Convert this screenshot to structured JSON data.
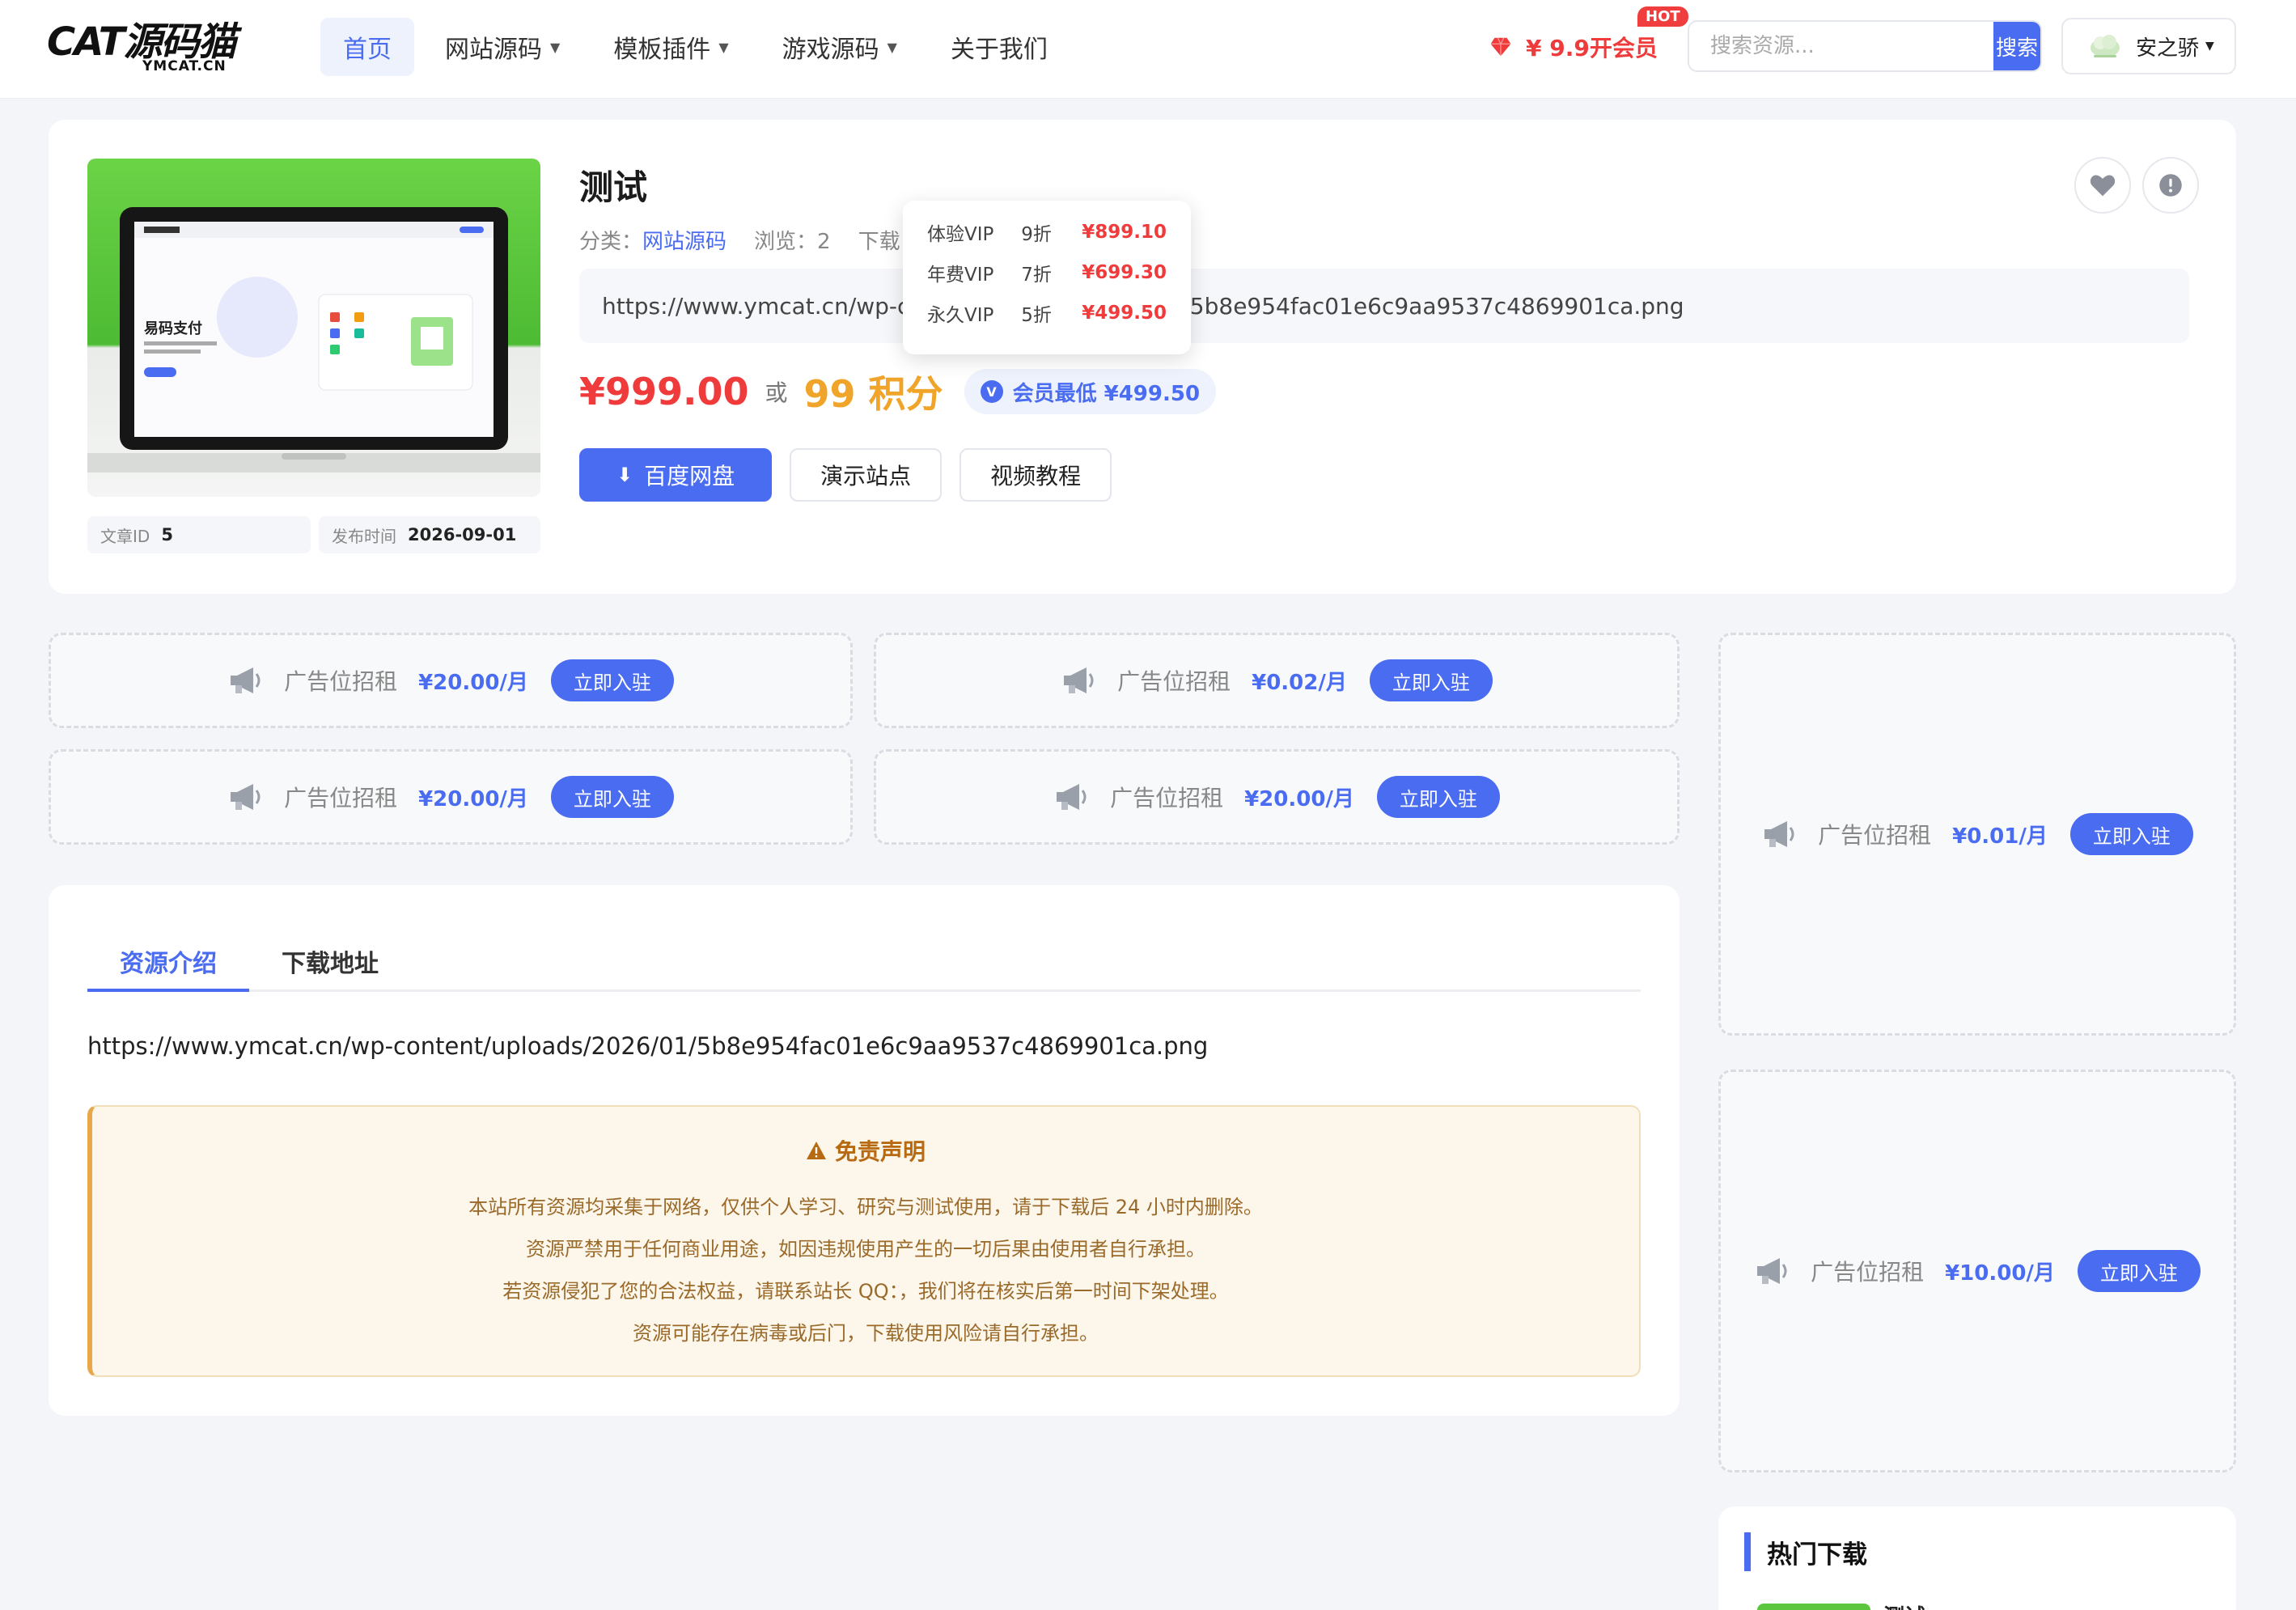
{
  "header": {
    "logo_main": "CAT源码猫",
    "logo_sub": "YMCAT.CN",
    "nav": [
      {
        "label": "首页",
        "active": true,
        "caret": false
      },
      {
        "label": "网站源码",
        "active": false,
        "caret": true
      },
      {
        "label": "模板插件",
        "active": false,
        "caret": true
      },
      {
        "label": "游戏源码",
        "active": false,
        "caret": true
      },
      {
        "label": "关于我们",
        "active": false,
        "caret": false
      }
    ],
    "vip_link": "¥ 9.9开会员",
    "hot_badge": "HOT",
    "search_placeholder": "搜索资源...",
    "search_button": "搜索",
    "user_name": "安之骄"
  },
  "product": {
    "title": "测试",
    "category_label": "分类：",
    "category_value": "网站源码",
    "views": "浏览：2",
    "downloads_label": "下载",
    "url": "https://www.ymcat.cn/wp-content/uploads/2026/01/5b8e954fac01e6c9aa9537c4869901ca.png",
    "price": "¥999.00",
    "or": "或",
    "points": "99 积分",
    "member_badge": "V",
    "member_min": "会员最低 ¥499.50",
    "buttons": {
      "primary": "百度网盘",
      "demo": "演示站点",
      "video": "视频教程"
    },
    "article_id_label": "文章ID",
    "article_id": "5",
    "publish_label": "发布时间",
    "publish_date": "2026-09-01",
    "thumb_text": "易码支付"
  },
  "vip_popup": [
    {
      "level": "体验VIP",
      "discount": "9折",
      "price": "¥899.10"
    },
    {
      "level": "年费VIP",
      "discount": "7折",
      "price": "¥699.30"
    },
    {
      "level": "永久VIP",
      "discount": "5折",
      "price": "¥499.50"
    }
  ],
  "ads": [
    {
      "text": "广告位招租",
      "price": "¥20.00/月",
      "button": "立即入驻"
    },
    {
      "text": "广告位招租",
      "price": "¥0.02/月",
      "button": "立即入驻"
    },
    {
      "text": "广告位招租",
      "price": "¥20.00/月",
      "button": "立即入驻"
    },
    {
      "text": "广告位招租",
      "price": "¥20.00/月",
      "button": "立即入驻"
    },
    {
      "text": "广告位招租",
      "price": "¥0.01/月",
      "button": "立即入驻"
    },
    {
      "text": "广告位招租",
      "price": "¥10.00/月",
      "button": "立即入驻"
    }
  ],
  "content": {
    "tabs": [
      "资源介绍",
      "下载地址"
    ],
    "desc_url": "https://www.ymcat.cn/wp-content/uploads/2026/01/5b8e954fac01e6c9aa9537c4869901ca.png",
    "disclaimer_title": "免责声明",
    "disclaimer_lines": [
      "本站所有资源均采集于网络，仅供个人学习、研究与测试使用，请于下载后 24 小时内删除。",
      "资源严禁用于任何商业用途，如因违规使用产生的一切后果由使用者自行承担。",
      "若资源侵犯了您的合法权益，请联系站长 QQ：，我们将在核实后第一时间下架处理。",
      "资源可能存在病毒或后门，下载使用风险请自行承担。"
    ]
  },
  "sidebar": {
    "hot_title": "热门下载",
    "hot_item_title": "测试"
  },
  "colors": {
    "accent": "#4a6cf0",
    "price_red": "#ef3b3b",
    "points_orange": "#f0a52a",
    "disclaimer_brown": "#b86a12"
  }
}
